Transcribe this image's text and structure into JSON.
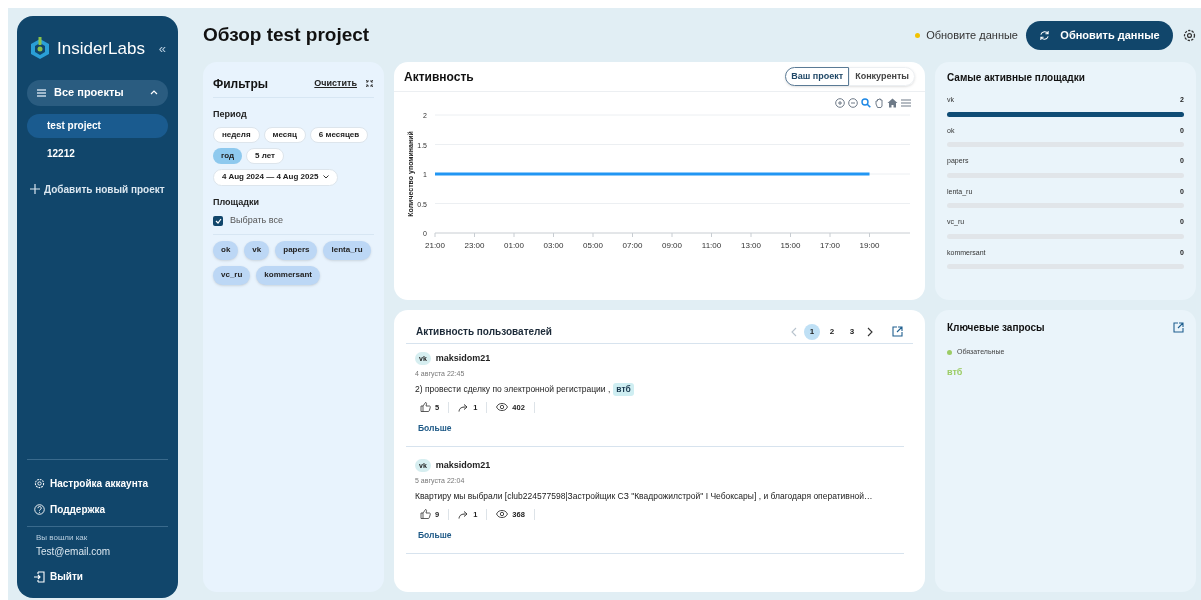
{
  "sidebar": {
    "brand": "InsiderLabs",
    "collapse": "«",
    "projects_group": {
      "label": "Все проекты",
      "expanded": true
    },
    "projects": [
      {
        "label": "test project",
        "selected": true
      },
      {
        "label": "12212",
        "selected": false
      }
    ],
    "add_project": "Добавить новый проект",
    "links": [
      {
        "kind": "settings",
        "label": "Настройка аккаунта"
      },
      {
        "kind": "support",
        "label": "Поддержка"
      }
    ],
    "signed_in_label": "Вы вошли как",
    "email": "Test@email.com",
    "logout": "Выйти"
  },
  "header": {
    "title": "Обзор test project",
    "notice": "Обновите данные",
    "refresh_button": "Обновить данные"
  },
  "filters": {
    "title": "Фильтры",
    "clear": "Очистить",
    "period_label": "Период",
    "periods": [
      {
        "label": "неделя",
        "selected": false
      },
      {
        "label": "месяц",
        "selected": false
      },
      {
        "label": "6 месяцев",
        "selected": false
      },
      {
        "label": "год",
        "selected": true
      },
      {
        "label": "5 лет",
        "selected": false
      }
    ],
    "date_range": "4 Aug 2024 — 4 Aug 2025",
    "platforms_label": "Площадки",
    "select_all": {
      "label": "Выбрать все",
      "checked": true
    },
    "platforms": [
      "ok",
      "vk",
      "papers",
      "lenta_ru",
      "vc_ru",
      "kommersant"
    ]
  },
  "activity": {
    "title": "Активность",
    "tabs": [
      {
        "label": "Ваш проект",
        "selected": true
      },
      {
        "label": "Конкуренты",
        "selected": false
      }
    ],
    "chart_data": {
      "type": "line",
      "ylabel": "Количество упоминаний",
      "categories": [
        "21:00",
        "23:00",
        "01:00",
        "03:00",
        "05:00",
        "07:00",
        "09:00",
        "11:00",
        "13:00",
        "15:00",
        "17:00",
        "19:00"
      ],
      "series": [
        {
          "color": "#2196f3",
          "values": [
            1,
            1,
            1,
            1,
            1,
            1,
            1,
            1,
            1,
            1,
            1,
            1
          ]
        }
      ],
      "grid": true,
      "ylim": [
        0,
        2
      ],
      "yticks": [
        0,
        0.5,
        1,
        1.5,
        2
      ]
    }
  },
  "top_sites": {
    "title": "Самые активные площадки",
    "items": [
      {
        "name": "vk",
        "value": "2",
        "level": 1
      },
      {
        "name": "ok",
        "value": "0",
        "level": 0
      },
      {
        "name": "papers",
        "value": "0",
        "level": 0
      },
      {
        "name": "lenta_ru",
        "value": "0",
        "level": 0
      },
      {
        "name": "vc_ru",
        "value": "0",
        "level": 0
      },
      {
        "name": "kommersant",
        "value": "0",
        "level": 0
      }
    ]
  },
  "user_activity": {
    "title": "Активность пользователей",
    "pagination": {
      "prev_disabled": true,
      "pages": [
        {
          "label": "1",
          "selected": true
        },
        {
          "label": "2",
          "selected": false
        },
        {
          "label": "3",
          "selected": false
        }
      ]
    },
    "posts": [
      {
        "source": "vk",
        "author": "maksidom21",
        "date": "4 августа 22:45",
        "text": "2) провести сделку по электронной регистрации ,",
        "keyword": "втб",
        "likes": "5",
        "reposts": "1",
        "views": "402",
        "more": "Больше"
      },
      {
        "source": "vk",
        "author": "maksidom21",
        "date": "5 августа 22:04",
        "text": "Квартиру мы выбрали [club224577598|Застройщик СЗ \"Квадрожилстрой\" I Чебоксары] , и благодаря оперативной…",
        "likes": "9",
        "reposts": "1",
        "views": "368",
        "more": "Больше"
      }
    ]
  },
  "key_queries": {
    "title": "Ключевые запросы",
    "groups": [
      {
        "label": "Обязательные",
        "color": "#9ccc65",
        "terms": [
          "втб"
        ]
      }
    ]
  }
}
